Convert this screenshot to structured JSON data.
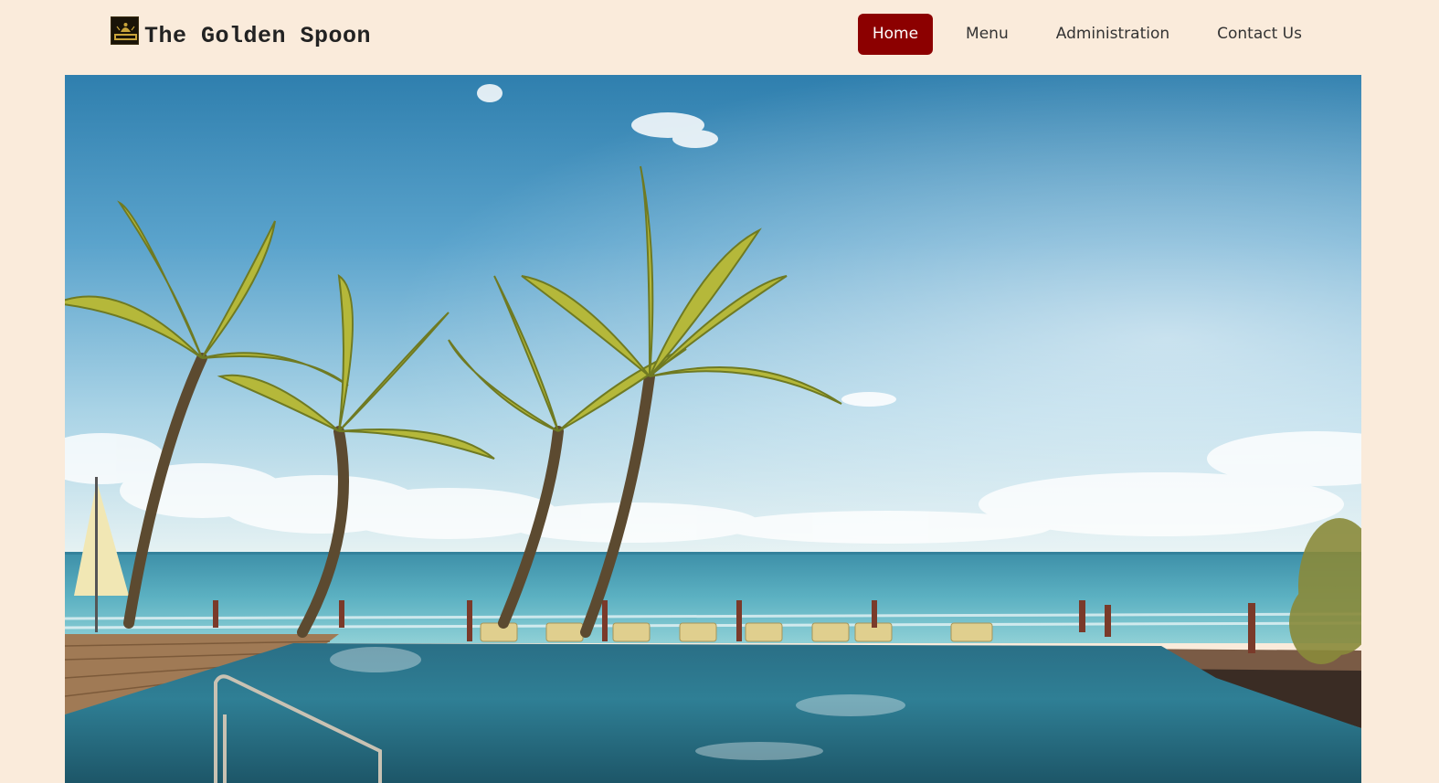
{
  "brand": {
    "name": "The Golden Spoon",
    "logo_icon": "golden-spoon-logo-icon"
  },
  "nav": {
    "items": [
      {
        "label": "Home",
        "active": true
      },
      {
        "label": "Menu",
        "active": false
      },
      {
        "label": "Administration",
        "active": false
      },
      {
        "label": "Contact Us",
        "active": false
      }
    ]
  },
  "colors": {
    "background": "#faebdb",
    "accent": "#8c0000"
  }
}
